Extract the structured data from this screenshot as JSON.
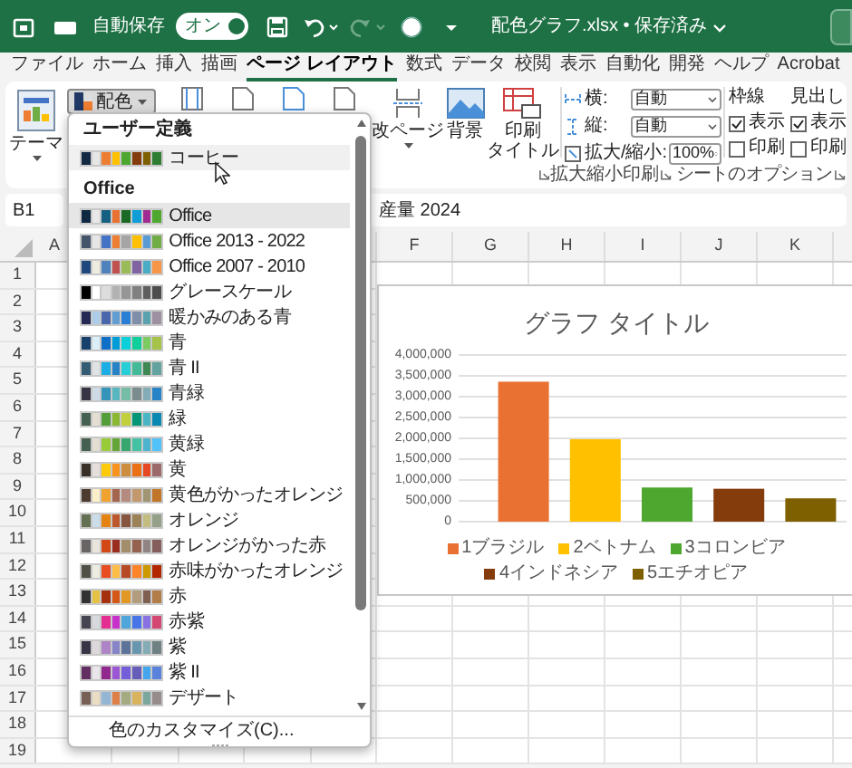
{
  "title_bar": {
    "autosave_label": "自動保存",
    "autosave_toggle": {
      "label": "オン",
      "on": true
    },
    "title": "配色グラフ.xlsx • 保存済み"
  },
  "menu_tabs": [
    {
      "label": "ファイル",
      "selected": false
    },
    {
      "label": "ホーム",
      "selected": false
    },
    {
      "label": "挿入",
      "selected": false
    },
    {
      "label": "描画",
      "selected": false
    },
    {
      "label": "ページ レイアウト",
      "selected": true
    },
    {
      "label": "数式",
      "selected": false
    },
    {
      "label": "データ",
      "selected": false
    },
    {
      "label": "校閲",
      "selected": false
    },
    {
      "label": "表示",
      "selected": false
    },
    {
      "label": "自動化",
      "selected": false
    },
    {
      "label": "開発",
      "selected": false
    },
    {
      "label": "ヘルプ",
      "selected": false
    },
    {
      "label": "Acrobat",
      "selected": false
    }
  ],
  "ribbon": {
    "theme_button": "テーマ",
    "colors_button": {
      "label": "配色",
      "expanded": true
    },
    "breaks_button": "改ページ",
    "background_button": "背景",
    "print_titles_button": [
      "印刷",
      "タイトル"
    ],
    "scale_group": {
      "width": {
        "label": "横:",
        "value": "自動"
      },
      "height": {
        "label": "縦:",
        "value": "自動"
      },
      "scale": {
        "label": "拡大/縮小:",
        "value": "100%"
      },
      "label": "拡大縮小印刷"
    },
    "sheet_options": {
      "columns": [
        {
          "title": "枠線",
          "options": [
            {
              "label": "表示",
              "checked": true
            },
            {
              "label": "印刷",
              "checked": false
            }
          ]
        },
        {
          "title": "見出し",
          "options": [
            {
              "label": "表示",
              "checked": true
            },
            {
              "label": "印刷",
              "checked": false
            }
          ]
        }
      ],
      "label": "シートのオプション"
    }
  },
  "formula_bar": {
    "name_box": "B1",
    "content": "産量 2024"
  },
  "sheet": {
    "columns": [
      "A",
      "F",
      "G",
      "H",
      "I",
      "J",
      "K"
    ],
    "rows": [
      "1",
      "2",
      "3",
      "4",
      "5",
      "6",
      "7",
      "8",
      "9",
      "10",
      "11",
      "12",
      "13",
      "14",
      "15",
      "16",
      "17",
      "18",
      "19"
    ]
  },
  "chart": {
    "legend": [
      {
        "label": "1ブラジル",
        "color": "#e97132"
      },
      {
        "label": "2ベトナム",
        "color": "#ffc000"
      },
      {
        "label": "3コロンビア",
        "color": "#4ea72e"
      },
      {
        "label": "4インドネシア",
        "color": "#843c0c"
      },
      {
        "label": "5エチオピア",
        "color": "#7f6000"
      }
    ],
    "chart_data": {
      "type": "bar",
      "title": "グラフ タイトル",
      "grid": true,
      "series": [
        {
          "values": [
            3360000,
            1980000,
            820000,
            790000,
            560000
          ]
        }
      ],
      "ylim": [
        0,
        4000000
      ],
      "yticks": [
        {
          "value": 0,
          "label": "0"
        },
        {
          "value": 500000,
          "label": "500,000"
        },
        {
          "value": 1000000,
          "label": "1,000,000"
        },
        {
          "value": 1500000,
          "label": "1,500,000"
        },
        {
          "value": 2000000,
          "label": "2,000,000"
        },
        {
          "value": 2500000,
          "label": "2,500,000"
        },
        {
          "value": 3000000,
          "label": "3,000,000"
        },
        {
          "value": 3500000,
          "label": "3,500,000"
        },
        {
          "value": 4000000,
          "label": "4,000,000"
        }
      ]
    }
  },
  "color_menu": {
    "custom_header": "ユーザー定義",
    "custom": [
      {
        "name": "コーヒー",
        "hovered": true,
        "swatch": [
          {
            "color": "#142a44"
          },
          {
            "color": "#e7e6e6"
          },
          {
            "color": "#ed7d31"
          },
          {
            "color": "#ffc000"
          },
          {
            "color": "#4ea72e"
          },
          {
            "color": "#843c0c"
          },
          {
            "color": "#7f6000"
          },
          {
            "color": "#2e7d32"
          }
        ]
      }
    ],
    "builtin_header": "Office",
    "builtin": [
      {
        "name": "Office",
        "selected": true,
        "swatch": [
          {
            "color": "#0e2841"
          },
          {
            "color": "#e8e8e8"
          },
          {
            "color": "#156082"
          },
          {
            "color": "#e97132"
          },
          {
            "color": "#196b24"
          },
          {
            "color": "#0f9ed5"
          },
          {
            "color": "#a02b93"
          },
          {
            "color": "#4ea72e"
          }
        ]
      },
      {
        "name": "Office 2013 - 2022",
        "selected": false,
        "swatch": [
          {
            "color": "#44546a"
          },
          {
            "color": "#e7e6e6"
          },
          {
            "color": "#4472c4"
          },
          {
            "color": "#ed7d31"
          },
          {
            "color": "#a5a5a5"
          },
          {
            "color": "#ffc000"
          },
          {
            "color": "#5b9bd5"
          },
          {
            "color": "#70ad47"
          }
        ]
      },
      {
        "name": "Office 2007 - 2010",
        "selected": false,
        "swatch": [
          {
            "color": "#1f497d"
          },
          {
            "color": "#eeece1"
          },
          {
            "color": "#4f81bd"
          },
          {
            "color": "#c0504d"
          },
          {
            "color": "#9bbb59"
          },
          {
            "color": "#8064a2"
          },
          {
            "color": "#4bacc6"
          },
          {
            "color": "#f79646"
          }
        ]
      },
      {
        "name": "グレースケール",
        "selected": false,
        "swatch": [
          {
            "color": "#000000"
          },
          {
            "color": "#ffffff"
          },
          {
            "color": "#dddddd"
          },
          {
            "color": "#b2b2b2"
          },
          {
            "color": "#969696"
          },
          {
            "color": "#808080"
          },
          {
            "color": "#5f5f5f"
          },
          {
            "color": "#4d4d4d"
          }
        ]
      },
      {
        "name": "暖かみのある青",
        "selected": false,
        "swatch": [
          {
            "color": "#242852"
          },
          {
            "color": "#acccea"
          },
          {
            "color": "#4a66ac"
          },
          {
            "color": "#629dd1"
          },
          {
            "color": "#297fd5"
          },
          {
            "color": "#7f8fa9"
          },
          {
            "color": "#5aa2ae"
          },
          {
            "color": "#9d90a0"
          }
        ]
      },
      {
        "name": "青",
        "selected": false,
        "swatch": [
          {
            "color": "#17406d"
          },
          {
            "color": "#dbeff9"
          },
          {
            "color": "#0f6fc6"
          },
          {
            "color": "#009dd9"
          },
          {
            "color": "#0bd0d9"
          },
          {
            "color": "#10cf9b"
          },
          {
            "color": "#7cca62"
          },
          {
            "color": "#a5c249"
          }
        ]
      },
      {
        "name": "青 II",
        "selected": false,
        "swatch": [
          {
            "color": "#335b74"
          },
          {
            "color": "#dfe3e5"
          },
          {
            "color": "#1cade4"
          },
          {
            "color": "#2683c6"
          },
          {
            "color": "#27ced7"
          },
          {
            "color": "#42ba97"
          },
          {
            "color": "#3e8853"
          },
          {
            "color": "#62a39f"
          }
        ]
      },
      {
        "name": "青緑",
        "selected": false,
        "swatch": [
          {
            "color": "#373545"
          },
          {
            "color": "#cedbe6"
          },
          {
            "color": "#3494ba"
          },
          {
            "color": "#58b6c0"
          },
          {
            "color": "#75bda7"
          },
          {
            "color": "#7a8c8e"
          },
          {
            "color": "#84acb6"
          },
          {
            "color": "#2683c6"
          }
        ]
      },
      {
        "name": "緑",
        "selected": false,
        "swatch": [
          {
            "color": "#455f51"
          },
          {
            "color": "#e3ded1"
          },
          {
            "color": "#549e39"
          },
          {
            "color": "#8ab833"
          },
          {
            "color": "#c0cf3a"
          },
          {
            "color": "#029676"
          },
          {
            "color": "#4ab5c4"
          },
          {
            "color": "#0989b1"
          }
        ]
      },
      {
        "name": "黄緑",
        "selected": false,
        "swatch": [
          {
            "color": "#455f51"
          },
          {
            "color": "#e3ded1"
          },
          {
            "color": "#99cb38"
          },
          {
            "color": "#63a537"
          },
          {
            "color": "#37a76f"
          },
          {
            "color": "#44c1a3"
          },
          {
            "color": "#4eb3cf"
          },
          {
            "color": "#51c3f9"
          }
        ]
      },
      {
        "name": "黄",
        "selected": false,
        "swatch": [
          {
            "color": "#39302a"
          },
          {
            "color": "#e5dedb"
          },
          {
            "color": "#ffca08"
          },
          {
            "color": "#f8931d"
          },
          {
            "color": "#ce8d3e"
          },
          {
            "color": "#ec7016"
          },
          {
            "color": "#e64823"
          },
          {
            "color": "#9c6a6a"
          }
        ]
      },
      {
        "name": "黄色がかったオレンジ",
        "selected": false,
        "swatch": [
          {
            "color": "#4e3b30"
          },
          {
            "color": "#fbeec9"
          },
          {
            "color": "#f0a22e"
          },
          {
            "color": "#a5644e"
          },
          {
            "color": "#b58b80"
          },
          {
            "color": "#c3986d"
          },
          {
            "color": "#a19574"
          },
          {
            "color": "#c17529"
          }
        ]
      },
      {
        "name": "オレンジ",
        "selected": false,
        "swatch": [
          {
            "color": "#637052"
          },
          {
            "color": "#ccddea"
          },
          {
            "color": "#e48312"
          },
          {
            "color": "#bd582c"
          },
          {
            "color": "#865640"
          },
          {
            "color": "#9b8357"
          },
          {
            "color": "#c2bc80"
          },
          {
            "color": "#94a088"
          }
        ]
      },
      {
        "name": "オレンジがかった赤",
        "selected": false,
        "swatch": [
          {
            "color": "#696464"
          },
          {
            "color": "#e9e5dc"
          },
          {
            "color": "#d34817"
          },
          {
            "color": "#9b2d1f"
          },
          {
            "color": "#a28e6a"
          },
          {
            "color": "#956251"
          },
          {
            "color": "#918485"
          },
          {
            "color": "#855d5d"
          }
        ]
      },
      {
        "name": "赤味がかったオレンジ",
        "selected": false,
        "swatch": [
          {
            "color": "#505046"
          },
          {
            "color": "#eeece1"
          },
          {
            "color": "#e84c22"
          },
          {
            "color": "#ffbd47"
          },
          {
            "color": "#b64926"
          },
          {
            "color": "#ff8427"
          },
          {
            "color": "#cc9900"
          },
          {
            "color": "#b22600"
          }
        ]
      },
      {
        "name": "赤",
        "selected": false,
        "swatch": [
          {
            "color": "#323232"
          },
          {
            "color": "#e5c243"
          },
          {
            "color": "#a5300f"
          },
          {
            "color": "#d55816"
          },
          {
            "color": "#e19825"
          },
          {
            "color": "#b19c7d"
          },
          {
            "color": "#7f5f52"
          },
          {
            "color": "#b27d49"
          }
        ]
      },
      {
        "name": "赤紫",
        "selected": false,
        "swatch": [
          {
            "color": "#454551"
          },
          {
            "color": "#d8d9dc"
          },
          {
            "color": "#e32d91"
          },
          {
            "color": "#c830cc"
          },
          {
            "color": "#4ea6dc"
          },
          {
            "color": "#4775e7"
          },
          {
            "color": "#8971e1"
          },
          {
            "color": "#d54773"
          }
        ]
      },
      {
        "name": "紫",
        "selected": false,
        "swatch": [
          {
            "color": "#373545"
          },
          {
            "color": "#dcd8dc"
          },
          {
            "color": "#ad84c6"
          },
          {
            "color": "#8784c7"
          },
          {
            "color": "#5d739a"
          },
          {
            "color": "#6997af"
          },
          {
            "color": "#84acb6"
          },
          {
            "color": "#6f8183"
          }
        ]
      },
      {
        "name": "紫 II",
        "selected": false,
        "swatch": [
          {
            "color": "#632e62"
          },
          {
            "color": "#eae5eb"
          },
          {
            "color": "#92278f"
          },
          {
            "color": "#9b57d3"
          },
          {
            "color": "#755dd9"
          },
          {
            "color": "#665eb8"
          },
          {
            "color": "#45a5ed"
          },
          {
            "color": "#5982db"
          }
        ]
      },
      {
        "name": "デザート",
        "selected": false,
        "swatch": [
          {
            "color": "#775f55"
          },
          {
            "color": "#ebddc3"
          },
          {
            "color": "#94b6d2"
          },
          {
            "color": "#dd8047"
          },
          {
            "color": "#a5ab81"
          },
          {
            "color": "#d8b25c"
          },
          {
            "color": "#7ba79d"
          },
          {
            "color": "#968c8c"
          }
        ]
      }
    ],
    "customize": "色のカスタマイズ(C)..."
  }
}
